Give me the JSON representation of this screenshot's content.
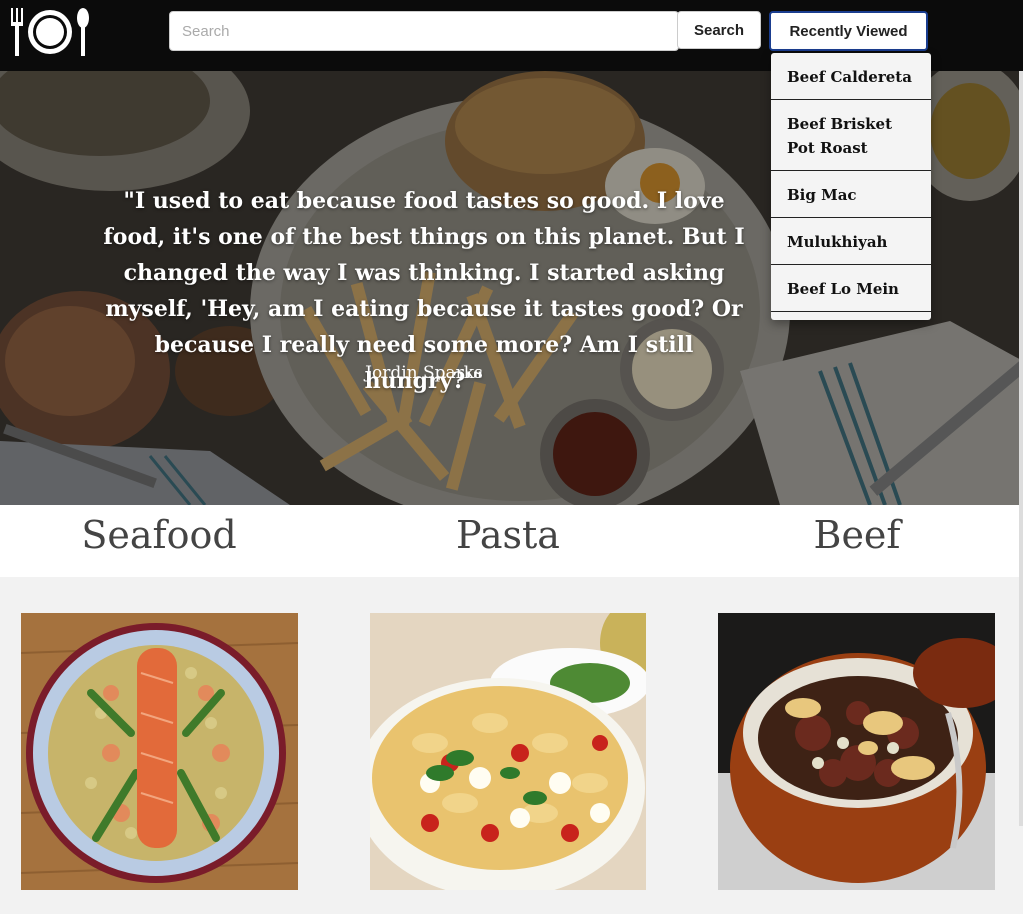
{
  "header": {
    "logo_icon": "plate-fork-spoon-icon",
    "search_placeholder": "Search",
    "search_value": "",
    "search_button": "Search",
    "recent_button": "Recently Viewed",
    "recent_border_color": "#1a3d8f"
  },
  "hero": {
    "quote": "\"I used to eat because food tastes so good. I love food, it's one of the best things on this planet. But I changed the way I was thinking. I started asking myself, 'Hey, am I eating because it tastes good? Or because I really need some more? Am I still hungry?'\"",
    "author": "Jordin Sparks"
  },
  "recently_viewed": [
    "Beef Caldereta",
    "Beef Brisket Pot Roast",
    "Big Mac",
    "Mulukhiyah",
    "Beef Lo Mein"
  ],
  "categories": [
    {
      "title": "Seafood"
    },
    {
      "title": "Pasta"
    },
    {
      "title": "Beef"
    }
  ]
}
